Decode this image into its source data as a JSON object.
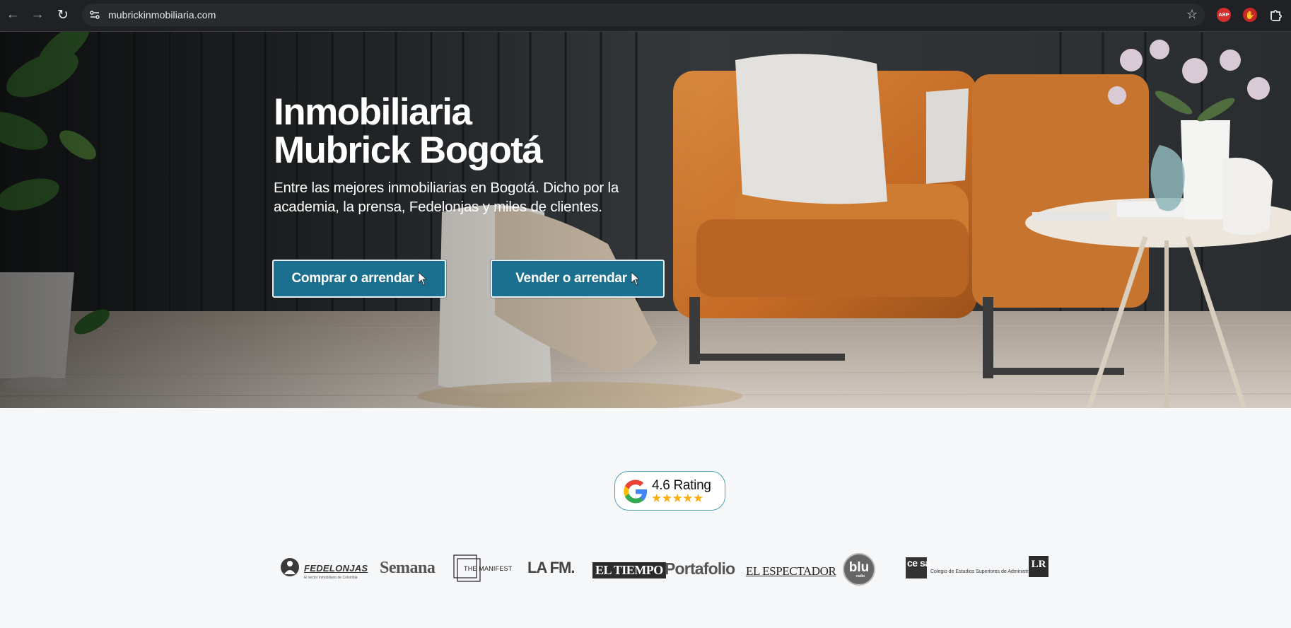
{
  "browser": {
    "url": "mubrickinmobiliaria.com",
    "back_icon": "arrow-left-icon",
    "forward_icon": "arrow-right-icon",
    "reload_icon": "reload-icon",
    "bookmark_icon": "star-icon",
    "extensions": [
      "adblock-plus-icon",
      "stop-hand-icon",
      "extensions-puzzle-icon"
    ],
    "abp_label": "ABP"
  },
  "hero": {
    "title_line1": "Inmobiliaria",
    "title_line2": "Mubrick Bogotá",
    "subtitle": "Entre las mejores inmobiliarias en Bogotá. Dicho por la academia, la prensa, Fedelonjas y miles de clientes.",
    "cta_buy": "Comprar o arrendar",
    "cta_sell": "Vender o arrendar",
    "button_color": "#1b6f8f"
  },
  "rating": {
    "text": "4.6 Rating",
    "stars": "★★★★★",
    "star_color": "#f9b017"
  },
  "press": {
    "fedelonjas": "FEDELONJAS",
    "fedelonjas_tag": "El sector inmobiliario de Colombia",
    "semana": "Semana",
    "manifest": "THE MANIFEST",
    "lafm": "LA FM.",
    "eltiempo": "EL TIEMPO",
    "portafolio": "Portafolio",
    "espectador": "EL ESPECTADOR",
    "blu": "blu",
    "blu_small": "radio",
    "cesa_mark": "ce sa",
    "cesa_text": "Colegio de Estudios Superiores de Administración",
    "lr": "LR"
  }
}
